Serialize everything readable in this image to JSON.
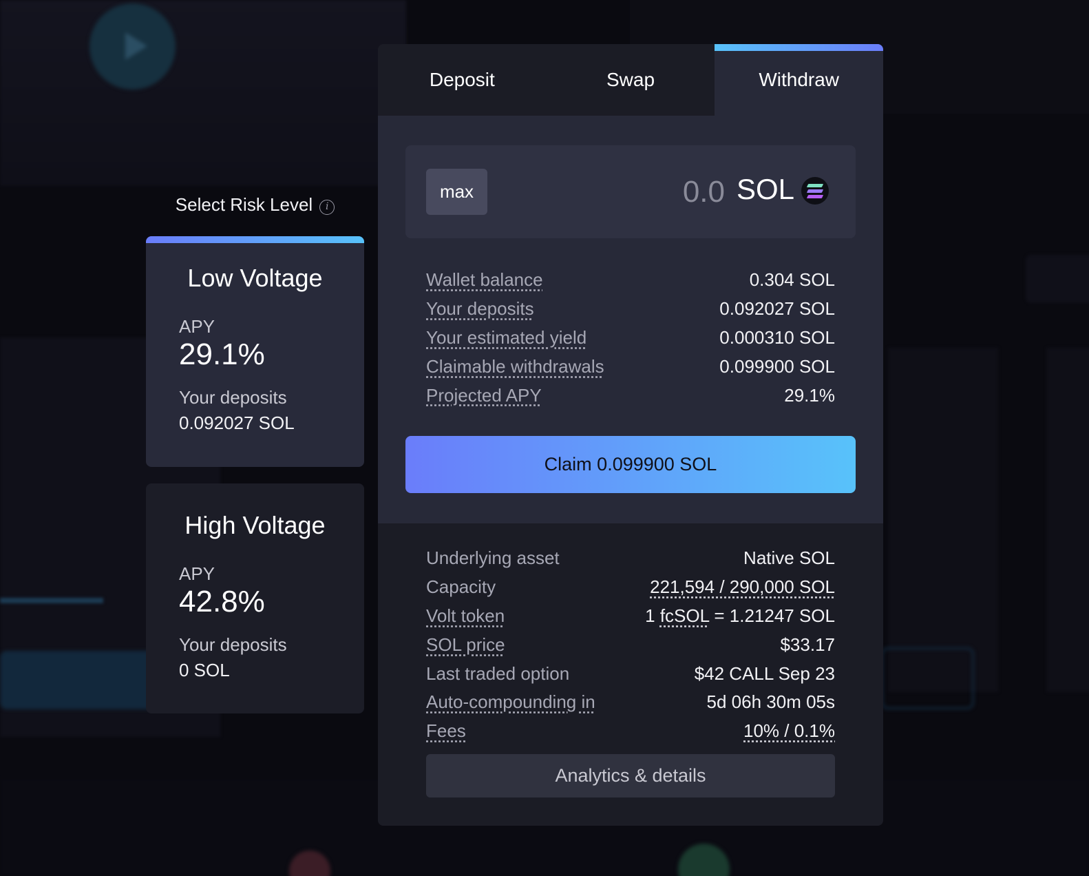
{
  "risk": {
    "title": "Select Risk Level",
    "info_glyph": "i",
    "cards": [
      {
        "name": "Low Voltage",
        "apy_label": "APY",
        "apy": "29.1%",
        "deposits_label": "Your deposits",
        "deposits": "0.092027 SOL"
      },
      {
        "name": "High Voltage",
        "apy_label": "APY",
        "apy": "42.8%",
        "deposits_label": "Your deposits",
        "deposits": "0 SOL"
      }
    ]
  },
  "tabs": [
    {
      "label": "Deposit"
    },
    {
      "label": "Swap"
    },
    {
      "label": "Withdraw",
      "active": true
    }
  ],
  "amount": {
    "max_label": "max",
    "value": "",
    "placeholder": "0.0",
    "unit": "SOL",
    "icon": "solana-icon"
  },
  "stats": [
    {
      "label": "Wallet balance",
      "value": "0.304 SOL"
    },
    {
      "label": "Your deposits",
      "value": "0.092027 SOL"
    },
    {
      "label": "Your estimated yield",
      "value": "0.000310 SOL"
    },
    {
      "label": "Claimable withdrawals",
      "value": "0.099900 SOL"
    },
    {
      "label": "Projected APY",
      "value": "29.1%"
    }
  ],
  "claim_label": "Claim 0.099900 SOL",
  "details": {
    "underlying_label": "Underlying asset",
    "underlying_value": "Native SOL",
    "capacity_label": "Capacity",
    "capacity_value": "221,594 / 290,000 SOL",
    "volt_label": "Volt token",
    "volt_prefix": "1 ",
    "volt_token": "fcSOL",
    "volt_suffix": " = 1.21247 SOL",
    "price_label": "SOL price",
    "price_value": "$33.17",
    "last_option_label": "Last traded option",
    "last_option_value": "$42 CALL Sep 23",
    "compound_label": "Auto-compounding in",
    "compound_value": "5d 06h 30m 05s",
    "fees_label": "Fees",
    "fees_value": "10% / 0.1%"
  },
  "analytics_label": "Analytics & details",
  "colors": {
    "accent_start": "#6a7dfa",
    "accent_end": "#58c2fa",
    "panel_dark": "#1b1c25",
    "panel_light": "#272938"
  }
}
